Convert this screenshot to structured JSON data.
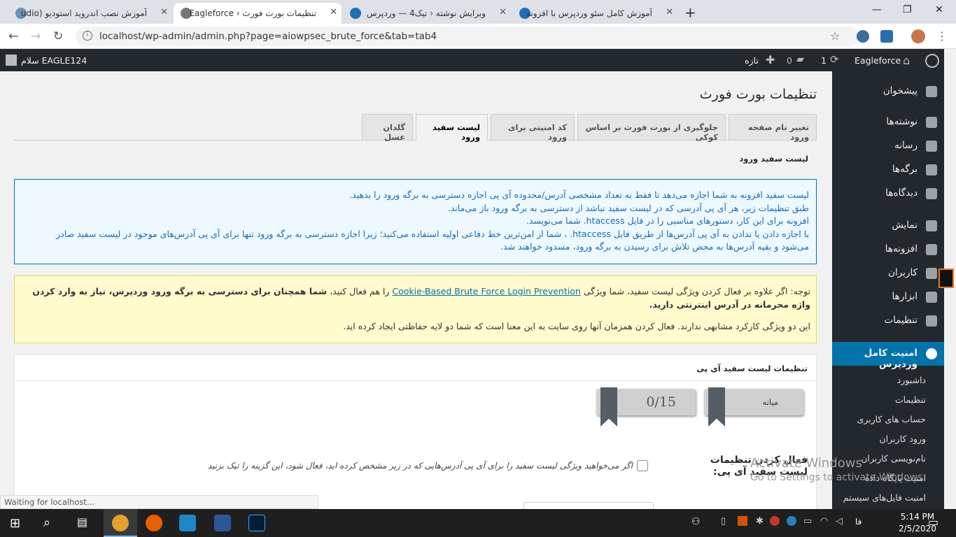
{
  "browser": {
    "tabs": [
      {
        "title": "آموزش نصب اندروید استودیو (udio",
        "active": false
      },
      {
        "title": "تنظیمات بورت فورث ‹ Eagleforce",
        "active": true
      },
      {
        "title": "ویرایش نوشته ‹ تیک4 — وردپرس",
        "active": false
      },
      {
        "title": "آموزش کامل سئو وردپرس با افزونه",
        "active": false
      }
    ],
    "url": "localhost/wp-admin/admin.php?page=aiowpsec_brute_force&tab=tab4",
    "status_text": "Waiting for localhost..."
  },
  "adminbar": {
    "site_name": "Eagleforce",
    "updates": "1",
    "comments": "0",
    "new_label": "تازه",
    "greeting": "سلام EAGLE124"
  },
  "sidebar": {
    "items": [
      {
        "label": "پیشخوان"
      },
      {
        "label": "نوشته‌ها"
      },
      {
        "label": "رسانه"
      },
      {
        "label": "برگه‌ها"
      },
      {
        "label": "دیدگاه‌ها"
      },
      {
        "label": "نمایش"
      },
      {
        "label": "افزونه‌ها"
      },
      {
        "label": "کاربران"
      },
      {
        "label": "ابزارها"
      },
      {
        "label": "تنظیمات"
      }
    ],
    "current": "امنیت کامل وردپرس",
    "subitems": [
      {
        "label": "داشبورد"
      },
      {
        "label": "تنظیمات"
      },
      {
        "label": "حساب های کاربری"
      },
      {
        "label": "ورود کاربران"
      },
      {
        "label": "نام‌نویسی کاربران"
      },
      {
        "label": "امنیت پایگاه داده"
      },
      {
        "label": "امنیت فایل‌های سیستم"
      }
    ]
  },
  "page": {
    "title": "تنظیمات بورت فورث",
    "tabs": [
      {
        "label": "تغییر نام صفحه ورود"
      },
      {
        "label": "جلوگیری از بورت فورث بر اساس کوکی"
      },
      {
        "label": "کد امنیتی برای ورود"
      },
      {
        "label": "لیست سفید ورود"
      },
      {
        "label": "گلدان عسل"
      }
    ],
    "section_title": "لیست سفید ورود",
    "info_lines": [
      "لیست سفید افزونه به شما اجازه می‌دهد تا فقط به تعداد مشخصی آدرس/محدوده آی پی اجازه دسترسی به برگه ورود را بدهید.",
      "طبق تنظیمات زیر، هر آی پی آدرسی که در لیست سفید نباشد از دسترسی به برگه ورود باز می‌ماند.",
      "افزونه برای این کار، دستورهای مناسبی را در فایل htaccess. شما می‌نویسد.",
      "با اجازه دادن یا ندادن به آی پی آدرس‌ها از طریق فایل htaccess. ، شما از امن‌ترین خط دفاعی اولیه استفاده می‌کنید؛ زیرا اجازه دسترسی به برگه ورود تنها برای آی پی آدرس‌های موجود در لیست سفید صادر",
      "می‌شود و بقیه آدرس‌ها به محض تلاش برای رسیدن به برگه ورود، مسدود خواهند شد."
    ],
    "warn_prefix": "توجه: اگر علاوه بر فعال کردن ویژگی لیست سفید، شما ویژگی ",
    "warn_link": "Cookie-Based Brute Force Login Prevention",
    "warn_mid": " را هم فعال کنید، ",
    "warn_bold": "شما همچنان برای دسترسی به برگه ورود وردپرس، نیاز به وارد کردن واژه محرمانه در آدرس اینترنتی دارید.",
    "warn_line2": "این دو ویژگی کارکرد مشابهی ندارند. فعال کردن همزمان آنها روی سایت به این معنا است که شما دو لایه حفاظتی ایجاد کرده اید.",
    "postbox_title": "تنظیمات لیست سفید آی پی",
    "badge_level": "میانه",
    "badge_score": "0/15",
    "field_label": "فعال کردن تنظیمات لیست سفید آی پی:",
    "field_desc": "اگر می‌خواهید ویژگی لیست سفید را برای آی پی آدرس‌هایی که در زیر مشخص کرده اید، فعال شود، این گزینه را تیک بزنید"
  },
  "watermark": {
    "line1": "Activate Windows",
    "line2": "Go to Settings to activate Windows."
  },
  "taskbar": {
    "time": "5:14 PM",
    "date": "2/5/2020",
    "lang": "فا"
  },
  "colors": {
    "wp_dark": "#23282d",
    "wp_blue": "#0073aa",
    "info_bg": "#edf8ff",
    "warn_bg": "#fffbcc"
  }
}
